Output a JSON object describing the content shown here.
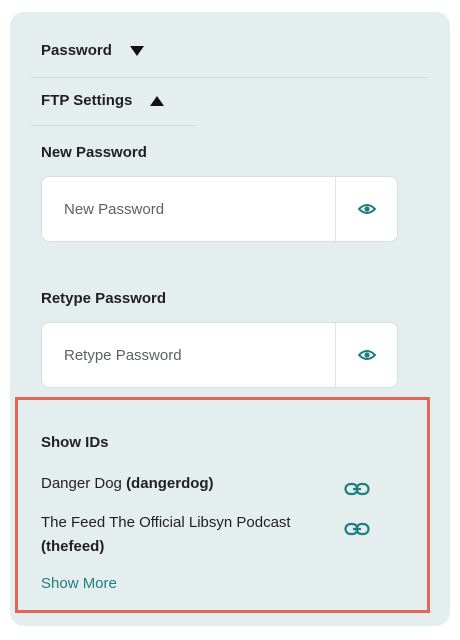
{
  "accordion": {
    "password_label": "Password",
    "ftp_label": "FTP Settings"
  },
  "new_password": {
    "label": "New Password",
    "placeholder": "New Password"
  },
  "retype_password": {
    "label": "Retype Password",
    "placeholder": "Retype Password"
  },
  "show_ids": {
    "title": "Show IDs",
    "items": [
      {
        "name": "Danger Dog",
        "id": "(dangerdog)"
      },
      {
        "name": "The Feed The Official Libsyn Podcast",
        "id": "(thefeed)"
      }
    ],
    "more_label": "Show More"
  },
  "colors": {
    "panel_bg": "#e4eeee",
    "accent_teal": "#1f7f7d",
    "highlight_border": "#e0665a"
  },
  "icons": {
    "reveal": "eye-icon",
    "link": "link-icon",
    "expand": "triangle-down-icon",
    "collapse": "triangle-up-icon"
  }
}
